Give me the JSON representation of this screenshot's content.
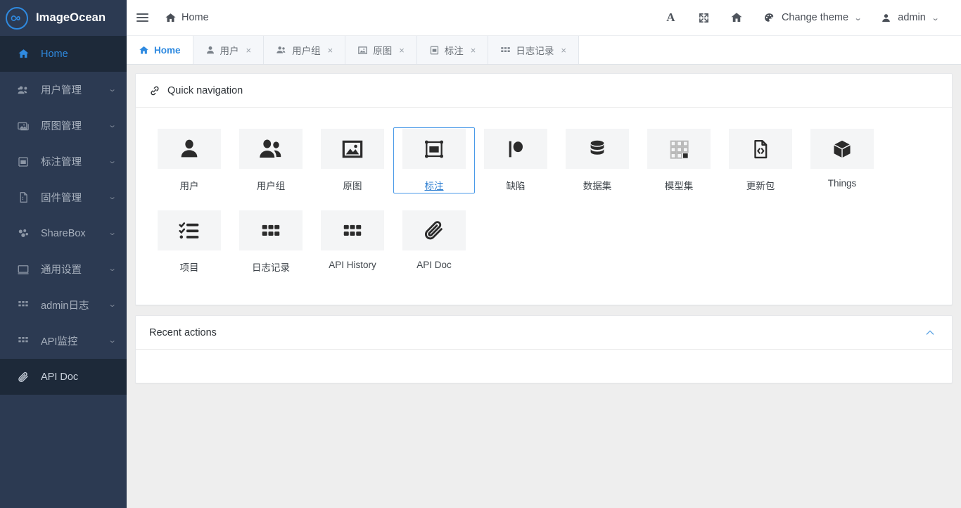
{
  "brand": {
    "name": "ImageOcean",
    "logo_icon": "infinity-circle-icon"
  },
  "sidebar": {
    "items": [
      {
        "label": "Home",
        "icon": "home-icon",
        "state": "active",
        "has_caret": false
      },
      {
        "label": "用户管理",
        "icon": "users-group-icon",
        "state": "normal",
        "has_caret": true
      },
      {
        "label": "原图管理",
        "icon": "images-icon",
        "state": "normal",
        "has_caret": true
      },
      {
        "label": "标注管理",
        "icon": "annotation-icon",
        "state": "normal",
        "has_caret": true
      },
      {
        "label": "固件管理",
        "icon": "firmware-file-icon",
        "state": "normal",
        "has_caret": true
      },
      {
        "label": "ShareBox",
        "icon": "sharebox-icon",
        "state": "normal",
        "has_caret": true
      },
      {
        "label": "通用设置",
        "icon": "monitor-icon",
        "state": "normal",
        "has_caret": true
      },
      {
        "label": "admin日志",
        "icon": "grid-dots-icon",
        "state": "normal",
        "has_caret": true
      },
      {
        "label": "API监控",
        "icon": "grid-dots-icon",
        "state": "normal",
        "has_caret": true
      },
      {
        "label": "API Doc",
        "icon": "paperclip-icon",
        "state": "current",
        "has_caret": false
      }
    ]
  },
  "topbar": {
    "menu_toggle_icon": "hamburger-icon",
    "breadcrumb": {
      "icon": "home-icon",
      "label": "Home"
    },
    "actions": [
      {
        "icon": "font-size-icon",
        "label": "A"
      },
      {
        "icon": "fullscreen-icon",
        "label": ""
      },
      {
        "icon": "home-icon",
        "label": ""
      }
    ],
    "theme": {
      "icon": "palette-icon",
      "label": "Change theme",
      "caret": "⌄"
    },
    "user": {
      "icon": "user-icon",
      "label": "admin",
      "caret": "⌄"
    }
  },
  "tabs": [
    {
      "label": "Home",
      "icon": "home-icon",
      "active": true,
      "closable": false
    },
    {
      "label": "用户",
      "icon": "user-icon",
      "active": false,
      "closable": true,
      "close": "×"
    },
    {
      "label": "用户组",
      "icon": "users-group-icon",
      "active": false,
      "closable": true,
      "close": "×"
    },
    {
      "label": "原图",
      "icon": "image-icon",
      "active": false,
      "closable": true,
      "close": "×"
    },
    {
      "label": "标注",
      "icon": "annotation-icon",
      "active": false,
      "closable": true,
      "close": "×"
    },
    {
      "label": "日志记录",
      "icon": "grid-dots-icon",
      "active": false,
      "closable": true,
      "close": "×"
    }
  ],
  "quick_navigation": {
    "title": "Quick navigation",
    "title_icon": "link-icon",
    "items": [
      {
        "label": "用户",
        "icon": "user-icon",
        "selected": false
      },
      {
        "label": "用户组",
        "icon": "users-group-icon",
        "selected": false
      },
      {
        "label": "原图",
        "icon": "image-icon",
        "selected": false
      },
      {
        "label": "标注",
        "icon": "annotation-icon",
        "selected": true
      },
      {
        "label": "缺陷",
        "icon": "defect-icon",
        "selected": false
      },
      {
        "label": "数据集",
        "icon": "database-icon",
        "selected": false
      },
      {
        "label": "模型集",
        "icon": "model-grid-icon",
        "selected": false
      },
      {
        "label": "更新包",
        "icon": "code-file-icon",
        "selected": false
      },
      {
        "label": "Things",
        "icon": "cube-icon",
        "selected": false
      },
      {
        "label": "项目",
        "icon": "checklist-icon",
        "selected": false
      },
      {
        "label": "日志记录",
        "icon": "grid-dots-icon",
        "selected": false
      },
      {
        "label": "API History",
        "icon": "grid-dots-icon",
        "selected": false
      },
      {
        "label": "API Doc",
        "icon": "paperclip-icon",
        "selected": false
      }
    ]
  },
  "recent_actions": {
    "title": "Recent actions",
    "collapse_icon": "chevron-up-icon",
    "items": []
  },
  "colors": {
    "sidebar_bg": "#2c3a52",
    "sidebar_active_bg": "#1d2939",
    "accent_blue": "#2f8ae0",
    "content_bg": "#eeeeee",
    "card_bg": "#ffffff",
    "thumb_bg": "#f4f5f6",
    "selected_border": "#4a9ae8"
  }
}
